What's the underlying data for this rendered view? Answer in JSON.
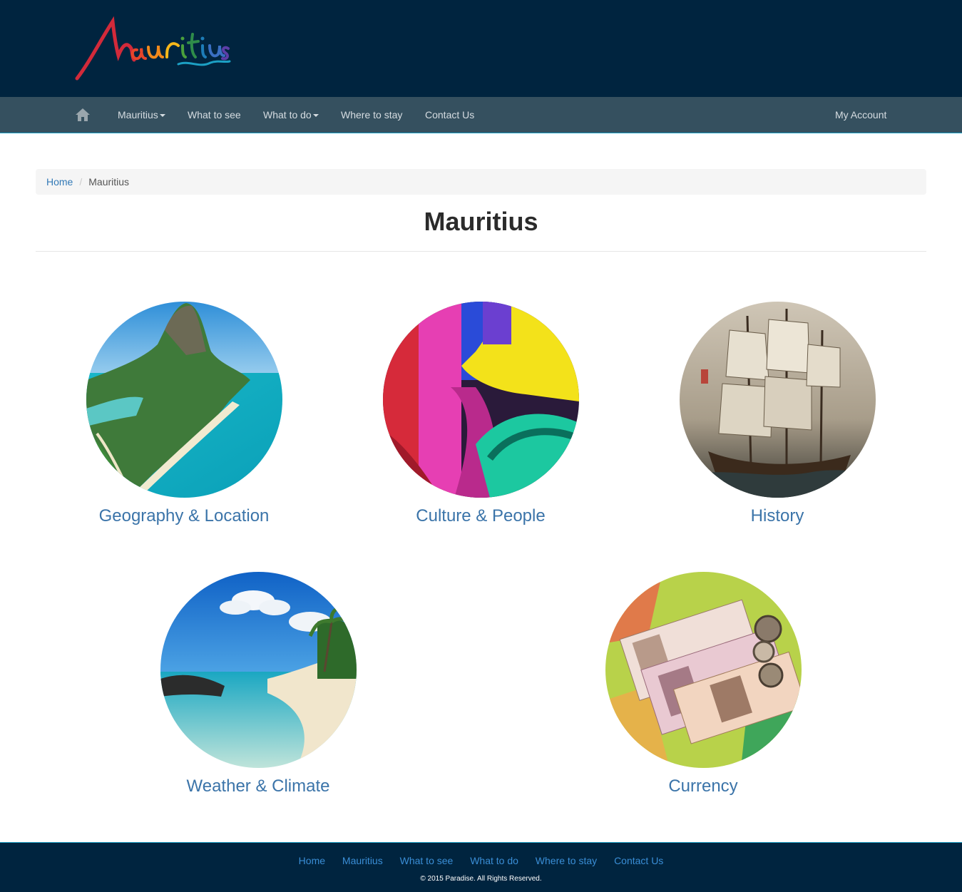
{
  "header": {
    "logo_text": "Mauritius"
  },
  "nav": {
    "items": [
      {
        "label": "Mauritius",
        "dropdown": true
      },
      {
        "label": "What to see",
        "dropdown": false
      },
      {
        "label": "What to do",
        "dropdown": true
      },
      {
        "label": "Where to stay",
        "dropdown": false
      },
      {
        "label": "Contact Us",
        "dropdown": false
      }
    ],
    "account": "My Account"
  },
  "breadcrumb": {
    "home": "Home",
    "current": "Mauritius"
  },
  "page": {
    "title": "Mauritius"
  },
  "cards": [
    {
      "label": "Geography & Location"
    },
    {
      "label": "Culture & People"
    },
    {
      "label": "History"
    },
    {
      "label": "Weather & Climate"
    },
    {
      "label": "Currency"
    }
  ],
  "footer": {
    "links": [
      "Home",
      "Mauritius",
      "What to see",
      "What to do",
      "Where to stay",
      "Contact Us"
    ],
    "copyright": "© 2015 Paradise. All Rights Reserved."
  },
  "colors": {
    "header_bg": "#00243f",
    "navbar_bg": "#35505f",
    "link": "#3b74a9",
    "footer_link": "#3a8ed6"
  }
}
